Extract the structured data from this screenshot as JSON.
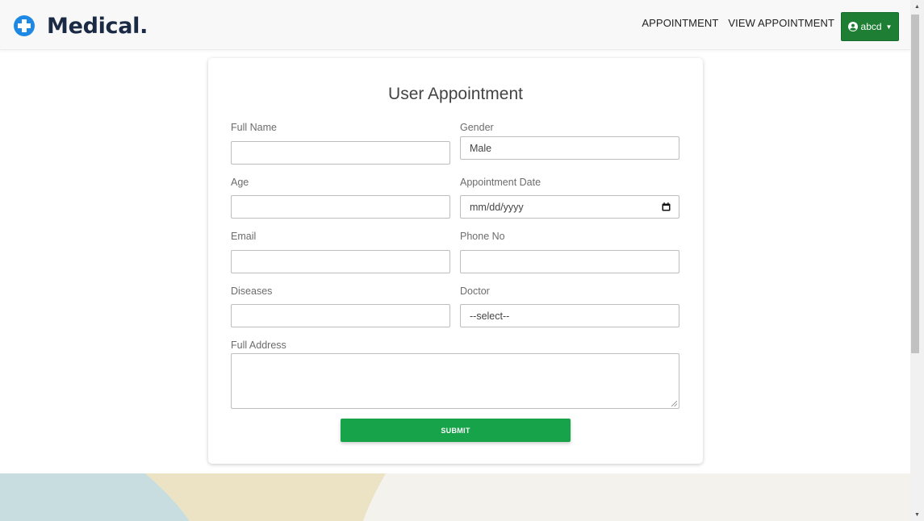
{
  "brand": {
    "name": "Medical.",
    "icon": "medical-cross-icon"
  },
  "nav": {
    "links": [
      "APPOINTMENT",
      "VIEW APPOINTMENT"
    ],
    "user_label": "abcd"
  },
  "form": {
    "title": "User Appointment",
    "full_name": {
      "label": "Full Name",
      "value": ""
    },
    "gender": {
      "label": "Gender",
      "value": "Male"
    },
    "age": {
      "label": "Age",
      "value": ""
    },
    "appointment_date": {
      "label": "Appointment Date",
      "placeholder": "mm/dd/yyyy"
    },
    "email": {
      "label": "Email",
      "value": ""
    },
    "phone": {
      "label": "Phone No",
      "value": ""
    },
    "diseases": {
      "label": "Diseases",
      "value": ""
    },
    "doctor": {
      "label": "Doctor",
      "value": "--select--"
    },
    "address": {
      "label": "Full Address",
      "value": ""
    },
    "submit_label": "SUBMIT"
  },
  "colors": {
    "accent_green": "#17a34a",
    "user_button": "#1e7e34",
    "brand_navy": "#1b2a44",
    "icon_blue": "#1e88e5"
  }
}
